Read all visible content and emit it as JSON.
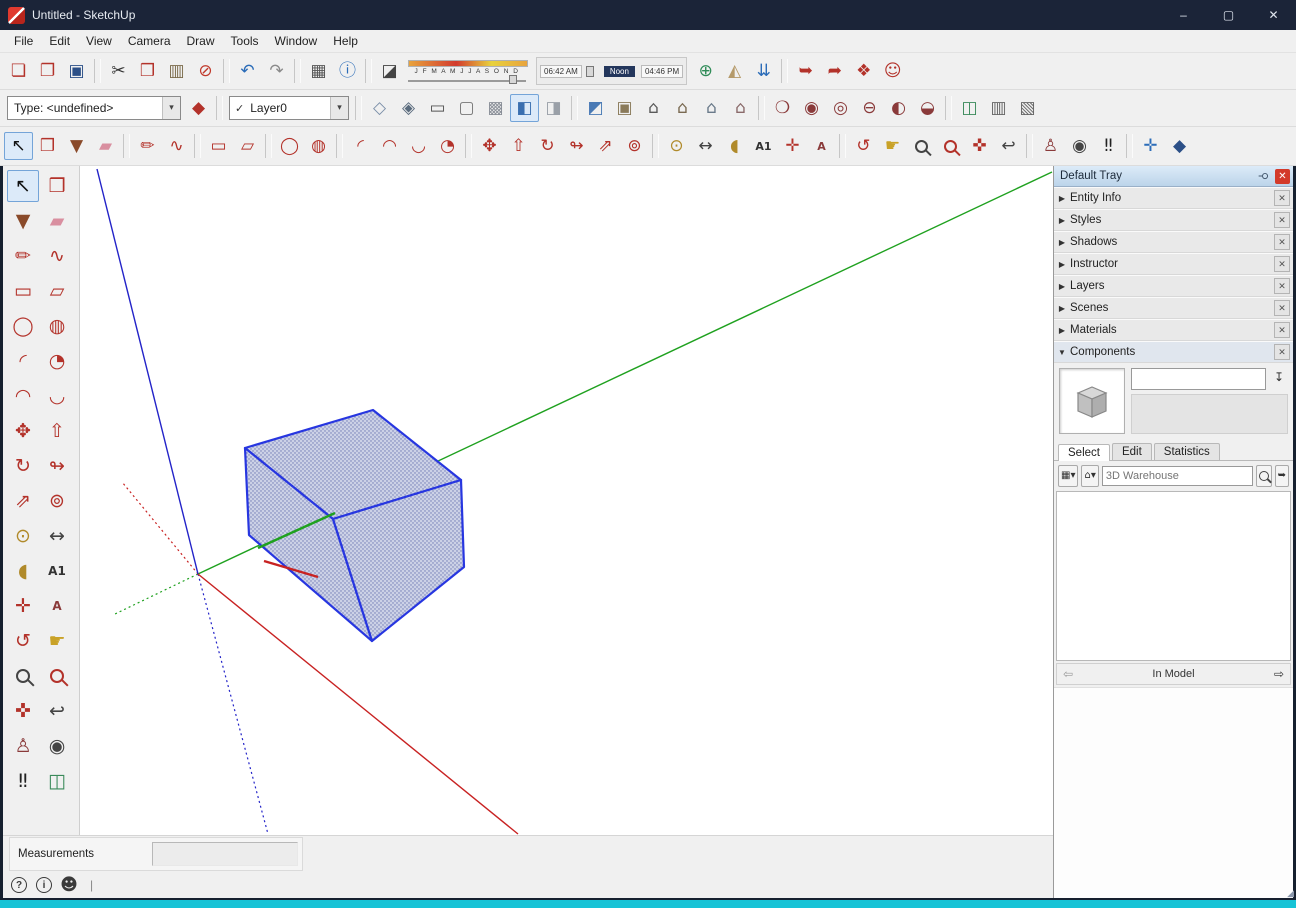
{
  "window": {
    "title": "Untitled - SketchUp",
    "minimize_glyph": "–",
    "maximize_glyph": "▢",
    "close_glyph": "✕"
  },
  "menu": {
    "items": [
      "File",
      "Edit",
      "View",
      "Camera",
      "Draw",
      "Tools",
      "Window",
      "Help"
    ]
  },
  "colors": {
    "axis-red": "#c82222",
    "axis-green": "#1fa11f",
    "axis-blue": "#2323c8",
    "box-edge": "#2736e0",
    "box-fill": "#ccd1e6",
    "box-dot": "#6f79b4",
    "selection-accent": "#74a4d8",
    "tray-close-red": "#d33a2a",
    "status-strip": "#17c3d6"
  },
  "toolbar1": {
    "items_a": [
      {
        "name": "new-button",
        "icon": "new-file-icon",
        "glyph": "❏",
        "color": "#b3322a"
      },
      {
        "name": "open-button",
        "icon": "open-folder-icon",
        "glyph": "❐",
        "color": "#b3322a"
      },
      {
        "name": "save-button",
        "icon": "save-floppy-icon",
        "glyph": "▣",
        "color": "#2b4f87"
      },
      {
        "name": "toolbar-divider",
        "cls": "sep"
      },
      {
        "name": "cut-button",
        "icon": "scissors-icon",
        "glyph": "✂",
        "color": "#333333"
      },
      {
        "name": "copy-button",
        "icon": "copy-icon",
        "glyph": "❒",
        "color": "#b3322a"
      },
      {
        "name": "paste-button",
        "icon": "clipboard-icon",
        "glyph": "▥",
        "color": "#7a6a4a"
      },
      {
        "name": "erase-button",
        "icon": "erase-icon",
        "glyph": "⊘",
        "color": "#c0392b"
      },
      {
        "name": "toolbar-divider",
        "cls": "sep"
      },
      {
        "name": "undo-button",
        "icon": "undo-arrow-icon",
        "glyph": "↶",
        "color": "#2b6cb8"
      },
      {
        "name": "redo-button",
        "icon": "redo-arrow-icon",
        "glyph": "↷",
        "color": "#8a8a8a"
      },
      {
        "name": "toolbar-divider",
        "cls": "sep"
      },
      {
        "name": "print-button",
        "icon": "printer-icon",
        "glyph": "▦",
        "color": "#555555"
      },
      {
        "name": "model-info-button",
        "icon": "model-info-icon",
        "glyph": "ⓘ",
        "color": "#2b6cb8"
      },
      {
        "name": "toolbar-divider",
        "cls": "sep"
      },
      {
        "name": "shadows-toggle-button",
        "icon": "shadow-box-icon",
        "glyph": "◪",
        "color": "#444444"
      }
    ],
    "items_b": [
      {
        "name": "geo-location-button",
        "icon": "globe-icon",
        "glyph": "⊕",
        "color": "#2e8b57"
      },
      {
        "name": "toggle-terrain-button",
        "icon": "terrain-icon",
        "glyph": "◭",
        "color": "#b59a6a"
      },
      {
        "name": "photo-textures-button",
        "icon": "photo-arrows-icon",
        "glyph": "⇊",
        "color": "#2b6cb8"
      },
      {
        "name": "toolbar-divider",
        "cls": "sep"
      },
      {
        "name": "warehouse-get-button",
        "icon": "warehouse-download-icon",
        "glyph": "➥",
        "color": "#b3322a"
      },
      {
        "name": "warehouse-upload-button",
        "icon": "warehouse-upload-icon",
        "glyph": "➦",
        "color": "#b3322a"
      },
      {
        "name": "send-to-layout-button",
        "icon": "layout-icon",
        "glyph": "❖",
        "color": "#b3322a"
      },
      {
        "name": "extension-warehouse-button",
        "icon": "extension-warehouse-icon",
        "glyph": "☺",
        "color": "#b3322a"
      }
    ]
  },
  "shadows": {
    "date_letters": "J F M A M J J A S O N D",
    "time_start": "06:42 AM",
    "time_noon": "Noon",
    "time_end": "04:46 PM"
  },
  "toolbar2": {
    "type_combo_value": "Type: <undefined>",
    "combo_arrow": "▾",
    "layer_check": "✓",
    "layer_combo_value": "Layer0",
    "lead_items": [
      {
        "name": "classifier-button",
        "icon": "classifier-tag-icon",
        "glyph": "◆",
        "color": "#b3322a"
      },
      {
        "name": "toolbar-divider",
        "cls": "sep"
      }
    ],
    "items": [
      {
        "name": "toolbar-divider",
        "cls": "sep"
      },
      {
        "name": "xray-button",
        "icon": "xray-icon",
        "glyph": "◇",
        "color": "#7b8fa8"
      },
      {
        "name": "back-edges-button",
        "icon": "back-edges-icon",
        "glyph": "◈",
        "color": "#5a6b7d"
      },
      {
        "name": "wireframe-button",
        "icon": "wireframe-icon",
        "glyph": "▭",
        "color": "#555555"
      },
      {
        "name": "hidden-line-button",
        "icon": "hidden-line-icon",
        "glyph": "▢",
        "color": "#777777"
      },
      {
        "name": "shaded-button",
        "icon": "shaded-icon",
        "glyph": "▩",
        "color": "#8a8f98"
      },
      {
        "name": "shaded-textures-button",
        "icon": "shaded-textures-icon",
        "glyph": "◧",
        "color": "#3a6fb0",
        "cls": "active"
      },
      {
        "name": "monochrome-button",
        "icon": "monochrome-icon",
        "glyph": "◨",
        "color": "#9aa0a8"
      },
      {
        "name": "toolbar-divider",
        "cls": "sep"
      },
      {
        "name": "iso-view-button",
        "icon": "iso-view-icon",
        "glyph": "◩",
        "color": "#4a7ab5"
      },
      {
        "name": "top-view-button",
        "icon": "top-view-icon",
        "glyph": "▣",
        "color": "#8a7a5a"
      },
      {
        "name": "front-view-button",
        "icon": "front-view-icon",
        "glyph": "⌂",
        "color": "#5a5a5a"
      },
      {
        "name": "right-view-button",
        "icon": "right-view-icon",
        "glyph": "⌂",
        "color": "#7a6a52"
      },
      {
        "name": "back-view-button",
        "icon": "back-view-icon",
        "glyph": "⌂",
        "color": "#6a7a8a"
      },
      {
        "name": "left-view-button",
        "icon": "left-view-icon",
        "glyph": "⌂",
        "color": "#8a6a6a"
      },
      {
        "name": "toolbar-divider",
        "cls": "sep"
      },
      {
        "name": "outer-shell-button",
        "icon": "outer-shell-icon",
        "glyph": "❍",
        "color": "#8a3a3a"
      },
      {
        "name": "intersect-button",
        "icon": "intersect-icon",
        "glyph": "◉",
        "color": "#8a3a3a"
      },
      {
        "name": "union-button",
        "icon": "union-icon",
        "glyph": "◎",
        "color": "#8a3a3a"
      },
      {
        "name": "subtract-button",
        "icon": "subtract-icon",
        "glyph": "⊖",
        "color": "#8a3a3a"
      },
      {
        "name": "trim-button",
        "icon": "trim-icon",
        "glyph": "◐",
        "color": "#8a3a3a"
      },
      {
        "name": "split-button",
        "icon": "split-icon",
        "glyph": "◒",
        "color": "#8a3a3a"
      },
      {
        "name": "toolbar-divider",
        "cls": "sep"
      },
      {
        "name": "section-plane-button",
        "icon": "section-plane-icon",
        "glyph": "◫",
        "color": "#3a8a5a"
      },
      {
        "name": "display-section-planes-button",
        "icon": "section-planes-icon",
        "glyph": "▥",
        "color": "#666666"
      },
      {
        "name": "display-section-cuts-button",
        "icon": "section-cuts-icon",
        "glyph": "▧",
        "color": "#666666"
      }
    ]
  },
  "toolbar3": {
    "items": [
      {
        "name": "select-button",
        "icon": "select-arrow-icon",
        "glyph": "↖",
        "color": "#111111",
        "cls": "active"
      },
      {
        "name": "make-component-button",
        "icon": "component-icon",
        "glyph": "❒",
        "color": "#b3322a"
      },
      {
        "name": "paint-bucket-button",
        "icon": "paint-bucket-icon",
        "glyph": "▼",
        "color": "#8a4a2a"
      },
      {
        "name": "eraser-button",
        "icon": "eraser-icon",
        "glyph": "▰",
        "color": "#d98fa0"
      },
      {
        "name": "toolbar-divider",
        "cls": "sep"
      },
      {
        "name": "line-button",
        "icon": "pencil-icon",
        "glyph": "✏",
        "color": "#b3322a"
      },
      {
        "name": "freehand-button",
        "icon": "freehand-icon",
        "glyph": "∿",
        "color": "#b3322a"
      },
      {
        "name": "toolbar-divider",
        "cls": "sep"
      },
      {
        "name": "rectangle-button",
        "icon": "rectangle-icon",
        "glyph": "▭",
        "color": "#b3322a"
      },
      {
        "name": "rotated-rectangle-button",
        "icon": "rotated-rectangle-icon",
        "glyph": "▱",
        "color": "#b3322a"
      },
      {
        "name": "toolbar-divider",
        "cls": "sep"
      },
      {
        "name": "circle-button",
        "icon": "circle-icon",
        "glyph": "◯",
        "color": "#b3322a"
      },
      {
        "name": "polygon-button",
        "icon": "polygon-icon",
        "glyph": "◍",
        "color": "#b3322a"
      },
      {
        "name": "toolbar-divider",
        "cls": "sep"
      },
      {
        "name": "arc-button",
        "icon": "arc-icon",
        "glyph": "◜",
        "color": "#b3322a"
      },
      {
        "name": "two-point-arc-button",
        "icon": "two-point-arc-icon",
        "glyph": "◠",
        "color": "#b3322a"
      },
      {
        "name": "three-point-arc-button",
        "icon": "three-point-arc-icon",
        "glyph": "◡",
        "color": "#b3322a"
      },
      {
        "name": "pie-button",
        "icon": "pie-icon",
        "glyph": "◔",
        "color": "#b3322a"
      },
      {
        "name": "toolbar-divider",
        "cls": "sep"
      },
      {
        "name": "move-button",
        "icon": "move-icon",
        "glyph": "✥",
        "color": "#b3322a"
      },
      {
        "name": "push-pull-button",
        "icon": "push-pull-icon",
        "glyph": "⇧",
        "color": "#b3322a"
      },
      {
        "name": "rotate-button",
        "icon": "rotate-icon",
        "glyph": "↻",
        "color": "#b3322a"
      },
      {
        "name": "follow-me-button",
        "icon": "follow-me-icon",
        "glyph": "↬",
        "color": "#b3322a"
      },
      {
        "name": "scale-button",
        "icon": "scale-icon",
        "glyph": "⇗",
        "color": "#b3322a"
      },
      {
        "name": "offset-button",
        "icon": "offset-icon",
        "glyph": "⊚",
        "color": "#b3322a"
      },
      {
        "name": "toolbar-divider",
        "cls": "sep"
      },
      {
        "name": "tape-measure-button",
        "icon": "tape-measure-icon",
        "glyph": "⊙",
        "color": "#b08a2a"
      },
      {
        "name": "dimension-button",
        "icon": "dimension-icon",
        "glyph": "↔",
        "color": "#444444"
      },
      {
        "name": "protractor-button",
        "icon": "protractor-icon",
        "glyph": "◖",
        "color": "#b08a2a"
      },
      {
        "name": "text-button",
        "icon": "text-icon",
        "glyph": "A1",
        "color": "#333333",
        "cls": "txt"
      },
      {
        "name": "axes-button",
        "icon": "axes-icon",
        "glyph": "✛",
        "color": "#b3322a"
      },
      {
        "name": "threed-text-button",
        "icon": "3d-text-icon",
        "glyph": "A",
        "color": "#8a3a3a",
        "cls": "txt"
      },
      {
        "name": "toolbar-divider",
        "cls": "sep"
      },
      {
        "name": "orbit-button",
        "icon": "orbit-icon",
        "glyph": "↺",
        "color": "#b3322a"
      },
      {
        "name": "pan-button",
        "icon": "pan-hand-icon",
        "glyph": "☛",
        "color": "#c9a227"
      },
      {
        "name": "zoom-button",
        "icon": "zoom-icon",
        "color": "#444444",
        "cls": "magbtn"
      },
      {
        "name": "zoom-window-button",
        "icon": "zoom-window-icon",
        "color": "#b3322a",
        "cls": "magbtn"
      },
      {
        "name": "zoom-extents-button",
        "icon": "zoom-extents-icon",
        "glyph": "✜",
        "color": "#b3322a"
      },
      {
        "name": "previous-button",
        "icon": "previous-view-icon",
        "glyph": "↩",
        "color": "#444444"
      },
      {
        "name": "toolbar-divider",
        "cls": "sep"
      },
      {
        "name": "position-camera-button",
        "icon": "position-camera-icon",
        "glyph": "♙",
        "color": "#8a3a3a"
      },
      {
        "name": "look-around-button",
        "icon": "look-around-eye-icon",
        "glyph": "◉",
        "color": "#444444"
      },
      {
        "name": "walk-button",
        "icon": "walk-footprints-icon",
        "glyph": "‼",
        "color": "#222222"
      },
      {
        "name": "toolbar-divider",
        "cls": "sep"
      },
      {
        "name": "axes-compass-button",
        "icon": "compass-icon",
        "glyph": "✛",
        "color": "#2b6cb8"
      },
      {
        "name": "navigation-button",
        "icon": "navigation-icon",
        "glyph": "◆",
        "color": "#2b4f87"
      }
    ]
  },
  "left_toolbar": {
    "items": [
      {
        "name": "select-button",
        "icon": "select-arrow-icon",
        "glyph": "↖",
        "color": "#111111",
        "cls": "active"
      },
      {
        "name": "make-component-button",
        "icon": "component-icon",
        "glyph": "❒",
        "color": "#b3322a"
      },
      {
        "name": "paint-bucket-button",
        "icon": "paint-bucket-icon",
        "glyph": "▼",
        "color": "#8a4a2a"
      },
      {
        "name": "eraser-button",
        "icon": "eraser-icon",
        "glyph": "▰",
        "color": "#d98fa0"
      },
      {
        "name": "line-button",
        "icon": "pencil-icon",
        "glyph": "✏",
        "color": "#b3322a"
      },
      {
        "name": "freehand-button",
        "icon": "freehand-icon",
        "glyph": "∿",
        "color": "#b3322a"
      },
      {
        "name": "rectangle-button",
        "icon": "rectangle-icon",
        "glyph": "▭",
        "color": "#b3322a"
      },
      {
        "name": "rotated-rectangle-button",
        "icon": "rotated-rectangle-icon",
        "glyph": "▱",
        "color": "#b3322a"
      },
      {
        "name": "circle-button",
        "icon": "circle-icon",
        "glyph": "◯",
        "color": "#b3322a"
      },
      {
        "name": "polygon-button",
        "icon": "polygon-icon",
        "glyph": "◍",
        "color": "#b3322a"
      },
      {
        "name": "arc-button",
        "icon": "arc-icon",
        "glyph": "◜",
        "color": "#b3322a"
      },
      {
        "name": "pie-button",
        "icon": "pie-icon",
        "glyph": "◔",
        "color": "#b3322a"
      },
      {
        "name": "two-point-arc-button",
        "icon": "two-point-arc-icon",
        "glyph": "◠",
        "color": "#b3322a"
      },
      {
        "name": "three-point-arc-button",
        "icon": "three-point-arc-icon",
        "glyph": "◡",
        "color": "#b3322a"
      },
      {
        "name": "move-button",
        "icon": "move-icon",
        "glyph": "✥",
        "color": "#b3322a"
      },
      {
        "name": "push-pull-button",
        "icon": "push-pull-icon",
        "glyph": "⇧",
        "color": "#b3322a"
      },
      {
        "name": "rotate-button",
        "icon": "rotate-icon",
        "glyph": "↻",
        "color": "#b3322a"
      },
      {
        "name": "follow-me-button",
        "icon": "follow-me-icon",
        "glyph": "↬",
        "color": "#b3322a"
      },
      {
        "name": "scale-button",
        "icon": "scale-icon",
        "glyph": "⇗",
        "color": "#b3322a"
      },
      {
        "name": "offset-button",
        "icon": "offset-icon",
        "glyph": "⊚",
        "color": "#b3322a"
      },
      {
        "name": "tape-measure-button",
        "icon": "tape-measure-icon",
        "glyph": "⊙",
        "color": "#b08a2a"
      },
      {
        "name": "dimension-button",
        "icon": "dimension-icon",
        "glyph": "↔",
        "color": "#444444"
      },
      {
        "name": "protractor-button",
        "icon": "protractor-icon",
        "glyph": "◖",
        "color": "#b08a2a"
      },
      {
        "name": "text-button",
        "icon": "text-icon",
        "glyph": "A1",
        "color": "#333333",
        "cls": "txt"
      },
      {
        "name": "axes-button",
        "icon": "axes-icon",
        "glyph": "✛",
        "color": "#b3322a"
      },
      {
        "name": "threed-text-button",
        "icon": "3d-text-icon",
        "glyph": "A",
        "color": "#8a3a3a",
        "cls": "txt"
      },
      {
        "name": "orbit-button",
        "icon": "orbit-icon",
        "glyph": "↺",
        "color": "#b3322a"
      },
      {
        "name": "pan-button",
        "icon": "pan-hand-icon",
        "glyph": "☛",
        "color": "#c9a227"
      },
      {
        "name": "zoom-button",
        "icon": "zoom-icon",
        "color": "#444444",
        "cls": "magbtn"
      },
      {
        "name": "zoom-window-button",
        "icon": "zoom-window-icon",
        "color": "#b3322a",
        "cls": "magbtn"
      },
      {
        "name": "zoom-extents-button",
        "icon": "zoom-extents-icon",
        "glyph": "✜",
        "color": "#b3322a"
      },
      {
        "name": "previous-button",
        "icon": "previous-view-icon",
        "glyph": "↩",
        "color": "#444444"
      },
      {
        "name": "position-camera-button",
        "icon": "position-camera-icon",
        "glyph": "♙",
        "color": "#8a3a3a"
      },
      {
        "name": "look-around-button",
        "icon": "look-around-eye-icon",
        "glyph": "◉",
        "color": "#444444"
      },
      {
        "name": "walk-button",
        "icon": "walk-footprints-icon",
        "glyph": "‼",
        "color": "#222222"
      },
      {
        "name": "section-plane-tool-button",
        "icon": "section-plane-icon",
        "glyph": "◫",
        "color": "#3a8a5a"
      }
    ]
  },
  "tray": {
    "title": "Default Tray",
    "pin_glyph": "⚲",
    "close_glyph": "✕",
    "section_close_glyph": "✕",
    "sections": [
      {
        "label": "Entity Info",
        "arrow": "▶"
      },
      {
        "label": "Styles",
        "arrow": "▶"
      },
      {
        "label": "Shadows",
        "arrow": "▶"
      },
      {
        "label": "Instructor",
        "arrow": "▶"
      },
      {
        "label": "Layers",
        "arrow": "▶"
      },
      {
        "label": "Scenes",
        "arrow": "▶"
      },
      {
        "label": "Materials",
        "arrow": "▶"
      }
    ],
    "components": {
      "label": "Components",
      "arrow": "▼",
      "secondary_pane_glyph": "↧",
      "tabs": [
        {
          "name": "tab-select",
          "label": "Select",
          "cls": "active"
        },
        {
          "name": "tab-edit",
          "label": "Edit"
        },
        {
          "name": "tab-statistics",
          "label": "Statistics"
        }
      ],
      "view_toggle_glyph": "▦",
      "dropdown_arrow": "▾",
      "home_glyph": "⌂",
      "search_placeholder": "3D Warehouse",
      "adv_search_glyph": "➥",
      "nav_prev_glyph": "⇦",
      "nav_label": "In Model",
      "nav_next_glyph": "⇨"
    }
  },
  "statusbar": {
    "measurements_label": "Measurements",
    "measurements_value": "",
    "geo_glyph": "?",
    "credits_glyph": "i",
    "account_glyph": "☻",
    "caret_glyph": "|"
  }
}
